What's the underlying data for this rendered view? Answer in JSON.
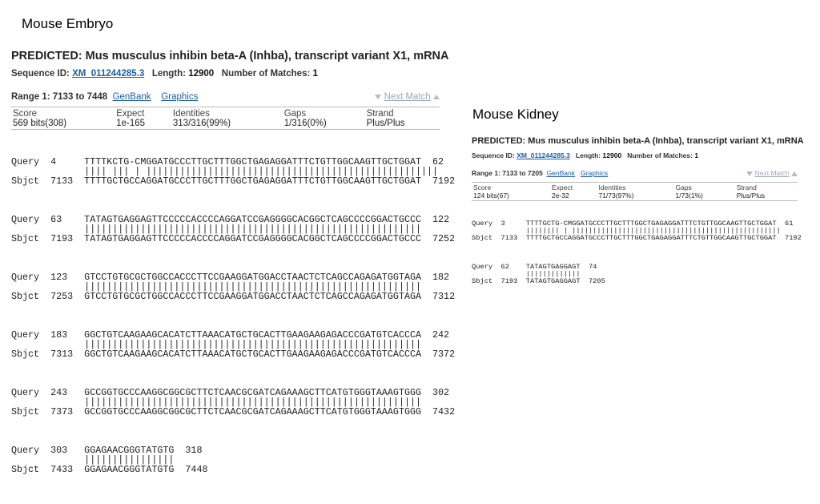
{
  "labels": {
    "left": "Mouse Embryo",
    "right": "Mouse Kidney"
  },
  "panels": {
    "embryo": {
      "title": "PREDICTED: Mus musculus inhibin beta-A (Inhba), transcript variant X1, mRNA",
      "seqid_label": "Sequence ID:",
      "seqid": "XM_011244285.3",
      "length_label": "Length:",
      "length": "12900",
      "matches_label": "Number of Matches:",
      "matches": "1",
      "range": "Range 1: 7133 to 7448",
      "genbank": "GenBank",
      "graphics": "Graphics",
      "next_match": "Next Match",
      "stats_headers": [
        "Score",
        "Expect",
        "Identities",
        "Gaps",
        "Strand"
      ],
      "stats_values": [
        "569 bits(308)",
        "1e-165",
        "313/316(99%)",
        "1/316(0%)",
        "Plus/Plus"
      ],
      "alignment": [
        {
          "query": "Query  4     TTTTKCTG-CMGGATGCCCTTGCTTTGGCTGAGAGGATTTCTGTTGGCAAGTTGCTGGAT  62",
          "match": "             |||| ||| | ||||||||||||||||||||||||||||||||||||||||||||||||||||",
          "sbjct": "Sbjct  7133  TTTTGCTGCCAGGATGCCCTTGCTTTGGCTGAGAGGATTTCTGTTGGCAAGTTGCTGGAT  7192"
        },
        {
          "query": "Query  63    TATAGTGAGGAGTTCCCCCACCCCAGGATCCGAGGGGCACGGCTCAGCCCCGGACTGCCC  122",
          "match": "             ||||||||||||||||||||||||||||||||||||||||||||||||||||||||||||",
          "sbjct": "Sbjct  7193  TATAGTGAGGAGTTCCCCCACCCCAGGATCCGAGGGGCACGGCTCAGCCCCGGACTGCCC  7252"
        },
        {
          "query": "Query  123   GTCCTGTGCGCTGGCCACCCTTCCGAAGGATGGACCTAACTCTCAGCCAGAGATGGTAGA  182",
          "match": "             ||||||||||||||||||||||||||||||||||||||||||||||||||||||||||||",
          "sbjct": "Sbjct  7253  GTCCTGTGCGCTGGCCACCCTTCCGAAGGATGGACCTAACTCTCAGCCAGAGATGGTAGA  7312"
        },
        {
          "query": "Query  183   GGCTGTCAAGAAGCACATCTTAAACATGCTGCACTTGAAGAAGAGACCCGATGTCACCCA  242",
          "match": "             ||||||||||||||||||||||||||||||||||||||||||||||||||||||||||||",
          "sbjct": "Sbjct  7313  GGCTGTCAAGAAGCACATCTTAAACATGCTGCACTTGAAGAAGAGACCCGATGTCACCCA  7372"
        },
        {
          "query": "Query  243   GCCGGTGCCCAAGGCGGCGCTTCTCAACGCGATCAGAAAGCTTCATGTGGGTAAAGTGGG  302",
          "match": "             ||||||||||||||||||||||||||||||||||||||||||||||||||||||||||||",
          "sbjct": "Sbjct  7373  GCCGGTGCCCAAGGCGGCGCTTCTCAACGCGATCAGAAAGCTTCATGTGGGTAAAGTGGG  7432"
        },
        {
          "query": "Query  303   GGAGAACGGGTATGTG  318",
          "match": "             ||||||||||||||||",
          "sbjct": "Sbjct  7433  GGAGAACGGGTATGTG  7448"
        }
      ]
    },
    "kidney": {
      "title": "PREDICTED: Mus musculus inhibin beta-A (Inhba), transcript variant X1, mRNA",
      "seqid_label": "Sequence ID:",
      "seqid": "XM_011244285.3",
      "length_label": "Length:",
      "length": "12900",
      "matches_label": "Number of Matches:",
      "matches": "1",
      "range": "Range 1: 7133 to 7205",
      "genbank": "GenBank",
      "graphics": "Graphics",
      "next_match": "Next Match",
      "stats_headers": [
        "Score",
        "Expect",
        "Identities",
        "Gaps",
        "Strand"
      ],
      "stats_values": [
        "124 bits(67)",
        "2e-32",
        "71/73(97%)",
        "1/73(1%)",
        "Plus/Plus"
      ],
      "alignment": [
        {
          "query": "Query  3     TTTTGCTG-CMGGATGCCCTTGCTTTGGCTGAGAGGATTTCTGTTGGCAAGTTGCTGGAT  61",
          "match": "             |||||||| | ||||||||||||||||||||||||||||||||||||||||||||||||||",
          "sbjct": "Sbjct  7133  TTTTGCTGCCAGGATGCCCTTGCTTTGGCTGAGAGGATTTCTGTTGGCAAGTTGCTGGAT  7192"
        },
        {
          "query": "Query  62    TATAGTGAGGAGT  74",
          "match": "             |||||||||||||",
          "sbjct": "Sbjct  7193  TATAGTGAGGAGT  7205"
        }
      ]
    }
  }
}
